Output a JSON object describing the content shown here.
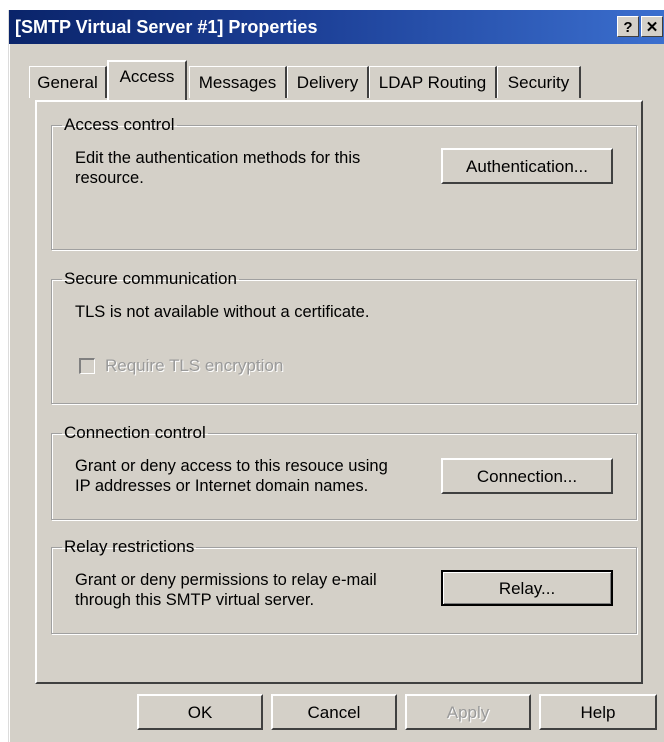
{
  "window": {
    "title": "[SMTP Virtual Server #1] Properties",
    "help_button": "?",
    "close_button": "✕"
  },
  "tabs": [
    {
      "label": "General"
    },
    {
      "label": "Access"
    },
    {
      "label": "Messages"
    },
    {
      "label": "Delivery"
    },
    {
      "label": "LDAP Routing"
    },
    {
      "label": "Security"
    }
  ],
  "active_tab": "Access",
  "access_control": {
    "legend": "Access control",
    "description_line1": "Edit the authentication methods for this",
    "description_line2": "resource.",
    "button": "Authentication..."
  },
  "secure_communication": {
    "legend": "Secure communication",
    "status": "TLS is not available without a certificate.",
    "checkbox_label": "Require TLS encryption",
    "checkbox_checked": false,
    "checkbox_enabled": false
  },
  "connection_control": {
    "legend": "Connection control",
    "description_line1": "Grant or deny access to this resouce using",
    "description_line2": "IP addresses or Internet domain names.",
    "button": "Connection..."
  },
  "relay_restrictions": {
    "legend": "Relay restrictions",
    "description_line1": "Grant or deny permissions to relay e-mail",
    "description_line2": "through this SMTP virtual server.",
    "button": "Relay..."
  },
  "footer": {
    "ok": "OK",
    "cancel": "Cancel",
    "apply": "Apply",
    "help": "Help"
  },
  "colors": {
    "titlebar": "#0a246a",
    "dialog_face": "#d4d0c8",
    "disabled_text": "#9a9a9a"
  }
}
